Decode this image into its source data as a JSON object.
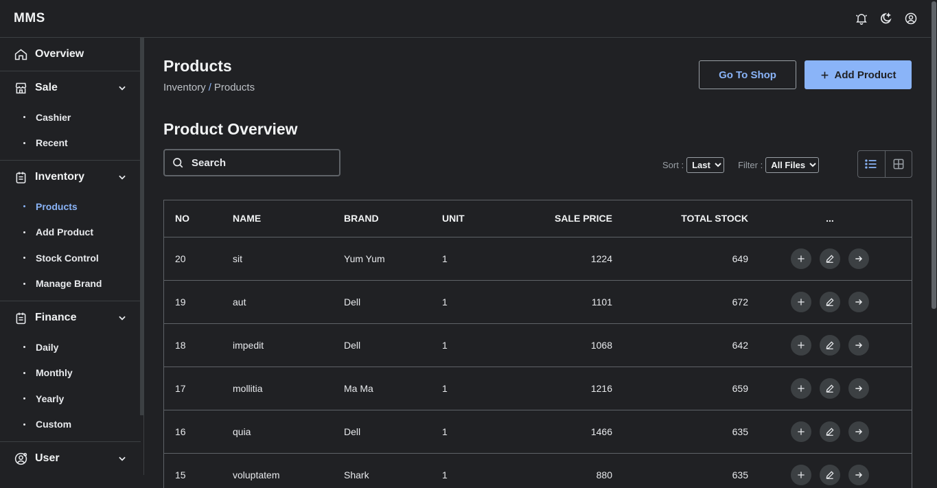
{
  "app": {
    "brand": "MMS"
  },
  "sidebar": {
    "overview": "Overview",
    "sale": {
      "label": "Sale",
      "items": [
        "Cashier",
        "Recent"
      ]
    },
    "inventory": {
      "label": "Inventory",
      "items": [
        "Products",
        "Add Product",
        "Stock Control",
        "Manage Brand"
      ],
      "active": "Products"
    },
    "finance": {
      "label": "Finance",
      "items": [
        "Daily",
        "Monthly",
        "Yearly",
        "Custom"
      ]
    },
    "user": {
      "label": "User"
    }
  },
  "page": {
    "title": "Products",
    "breadcrumb": {
      "parent": "Inventory",
      "separator": "/",
      "current": "Products"
    },
    "go_to_shop": "Go To Shop",
    "add_product": "Add Product",
    "section_title": "Product Overview",
    "search_placeholder": "Search",
    "sort_label": "Sort :",
    "sort_value": "Last",
    "filter_label": "Filter :",
    "filter_value": "All Files"
  },
  "table": {
    "headers": {
      "no": "NO",
      "name": "NAME",
      "brand": "BRAND",
      "unit": "UNIT",
      "price": "SALE PRICE",
      "stock": "TOTAL STOCK",
      "actions": "..."
    },
    "rows": [
      {
        "no": "20",
        "name": "sit",
        "brand": "Yum Yum",
        "unit": "1",
        "price": "1224",
        "stock": "649"
      },
      {
        "no": "19",
        "name": "aut",
        "brand": "Dell",
        "unit": "1",
        "price": "1101",
        "stock": "672"
      },
      {
        "no": "18",
        "name": "impedit",
        "brand": "Dell",
        "unit": "1",
        "price": "1068",
        "stock": "642"
      },
      {
        "no": "17",
        "name": "mollitia",
        "brand": "Ma Ma",
        "unit": "1",
        "price": "1216",
        "stock": "659"
      },
      {
        "no": "16",
        "name": "quia",
        "brand": "Dell",
        "unit": "1",
        "price": "1466",
        "stock": "635"
      },
      {
        "no": "15",
        "name": "voluptatem",
        "brand": "Shark",
        "unit": "1",
        "price": "880",
        "stock": "635"
      }
    ]
  },
  "colors": {
    "accent": "#8ab4f8",
    "background": "#202124",
    "border": "#5f6368"
  }
}
